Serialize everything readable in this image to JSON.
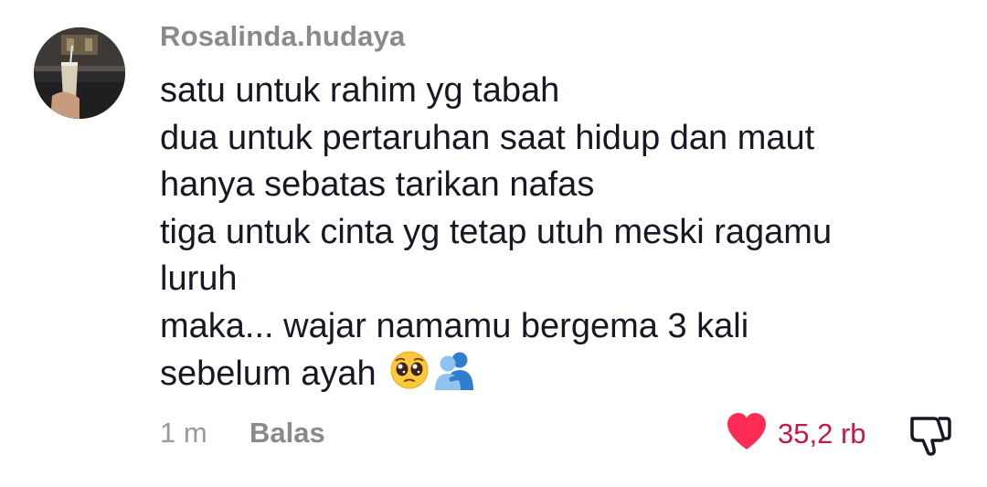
{
  "comment": {
    "username": "Rosalinda.hudaya",
    "lines": [
      "satu untuk rahim yg tabah",
      "dua untuk pertaruhan saat hidup dan maut",
      "hanya sebatas tarikan nafas",
      "tiga untuk cinta yg tetap utuh meski ragamu",
      "luruh",
      "maka... wajar namamu bergema 3 kali",
      "sebelum ayah"
    ],
    "emojis": [
      "pleading-face-emoji",
      "people-hugging-emoji"
    ],
    "timestamp": "1 m",
    "reply_label": "Balas",
    "like_count": "35,2 rb",
    "liked": true,
    "icons": {
      "like": "heart-icon",
      "dislike": "thumbs-down-icon"
    },
    "colors": {
      "heart": "#fe2c55",
      "like_count": "#c41a4b",
      "username": "#8a8a8a",
      "text": "#161823"
    }
  }
}
